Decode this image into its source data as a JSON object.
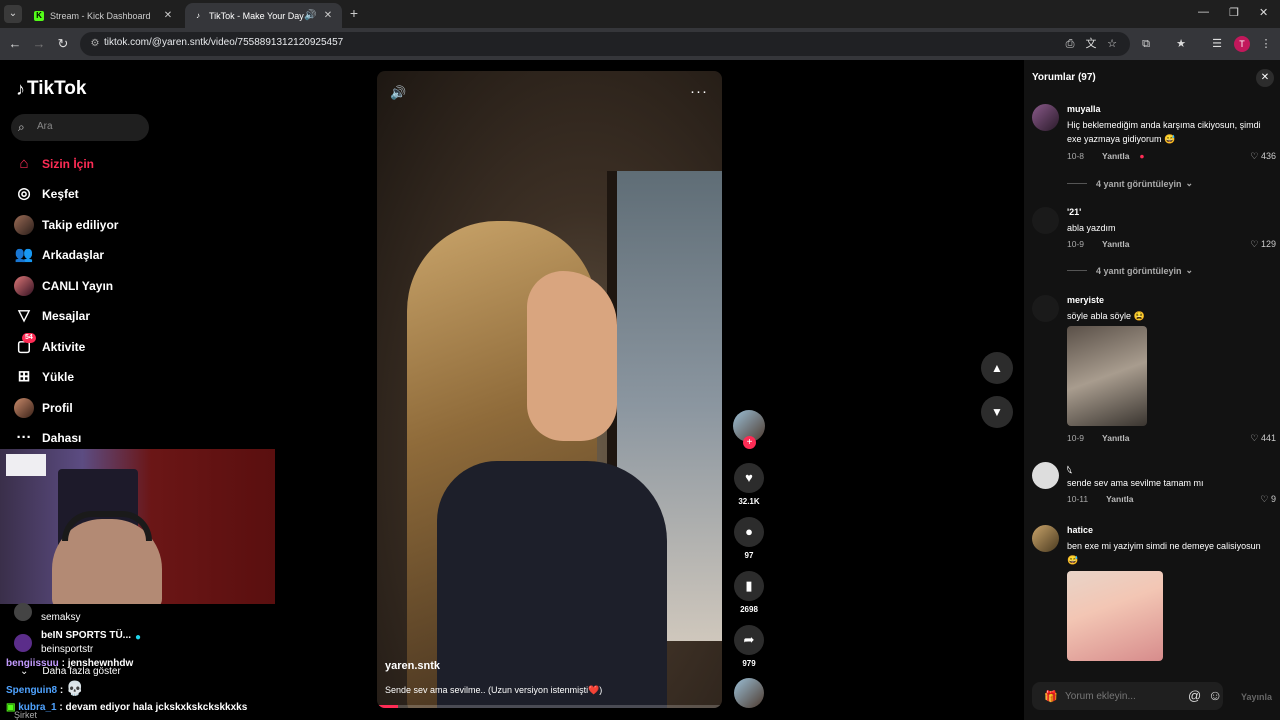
{
  "browser": {
    "tabs": [
      {
        "title": "Stream - Kick Dashboard",
        "favicon": "K"
      },
      {
        "title": "TikTok - Make Your Day",
        "favicon": "♪"
      }
    ],
    "url": "tiktok.com/@yaren.sntk/video/7558891312120925457",
    "profile_initial": "T"
  },
  "tiktok": {
    "logo_text": "TikTok",
    "search_placeholder": "Ara",
    "nav": [
      {
        "label": "Sizin İçin",
        "icon": "home-icon"
      },
      {
        "label": "Keşfet",
        "icon": "compass-icon"
      },
      {
        "label": "Takip ediliyor",
        "icon": "following-avatar-icon"
      },
      {
        "label": "Arkadaşlar",
        "icon": "friends-icon"
      },
      {
        "label": "CANLI Yayın",
        "icon": "live-avatar-icon"
      },
      {
        "label": "Mesajlar",
        "icon": "messages-icon"
      },
      {
        "label": "Aktivite",
        "icon": "activity-icon",
        "badge": "54"
      },
      {
        "label": "Yükle",
        "icon": "upload-icon"
      },
      {
        "label": "Profil",
        "icon": "profile-avatar-icon"
      },
      {
        "label": "Dahası",
        "icon": "more-icon"
      }
    ],
    "accent": "#fe2c55"
  },
  "overlay": {
    "rows": [
      {
        "name": "semaksy"
      },
      {
        "name": "beIN SPORTS TÜ...",
        "sub": "beinsportstr"
      }
    ],
    "show_more": "Daha fazla göster",
    "chat": [
      {
        "user": "bengiissuu",
        "message": "jenshewnhdw"
      },
      {
        "user": "Spenguin8",
        "message": ""
      },
      {
        "user": "kubra_1",
        "message": "devam ediyor hala jckskxkskckskkxks"
      }
    ],
    "footer_text": "Şirket"
  },
  "video": {
    "author": "yaren.sntk",
    "caption": "Sende sev ama sevilme.. (Uzun versiyon istenmişti❤️)",
    "progress": 0.06
  },
  "actions": {
    "likes": "32.1K",
    "comments": "97",
    "saves": "2698",
    "shares": "979"
  },
  "comments_panel": {
    "title": "Yorumlar (97)",
    "reply_label": "Yanıtla",
    "input_placeholder": "Yorum ekleyin...",
    "post_label": "Yayınla",
    "items": [
      {
        "user": "muyalla",
        "text": "Hiç beklemediğim anda karşıma cikiyosun, şimdi exe yazmaya gidiyorum 😅",
        "date": "10-8",
        "likes": "436",
        "replies": "4 yanıt görüntüleyin"
      },
      {
        "user": "'21'",
        "text": "abla yazdım",
        "date": "10-9",
        "likes": "129",
        "replies": "4 yanıt görüntüleyin"
      },
      {
        "user": "meryiste",
        "text": "söyle abla söyle 😫",
        "date": "10-9",
        "likes": "441"
      },
      {
        "user": "𓆩",
        "text": "sende sev ama sevilme tamam mı",
        "date": "10-11",
        "likes": "9"
      },
      {
        "user": "hatice",
        "text": "ben exe mi yaziyim simdi ne demeye calisiyosun😅"
      }
    ]
  }
}
